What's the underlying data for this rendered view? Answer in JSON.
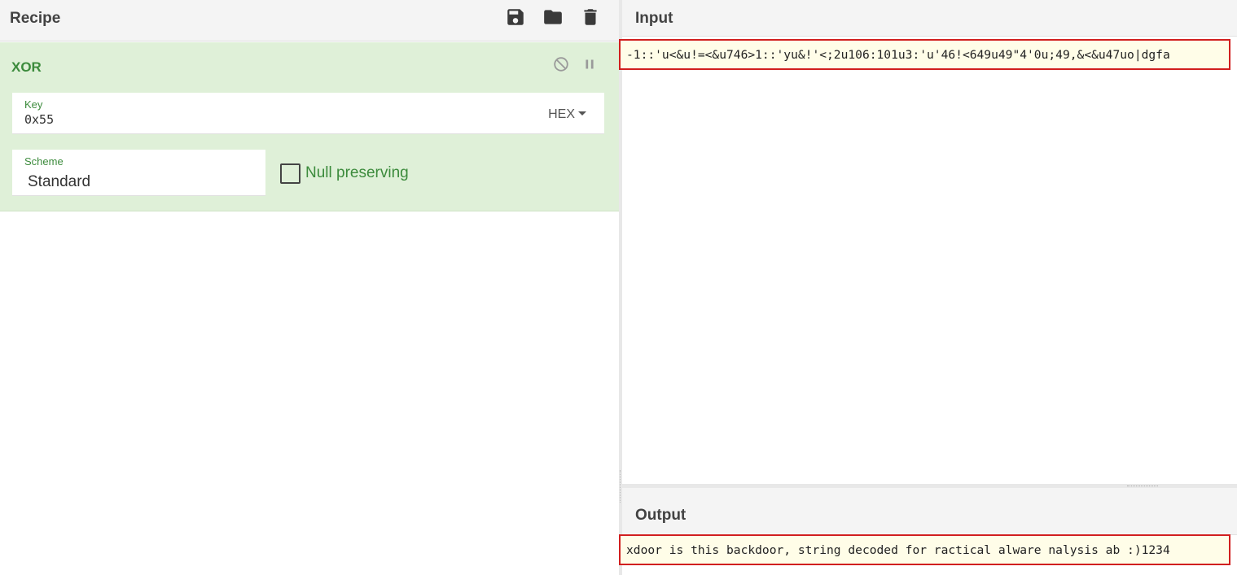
{
  "recipe": {
    "title": "Recipe",
    "icons": {
      "save": "save-icon",
      "load": "folder-icon",
      "clear": "trash-icon"
    },
    "operation": {
      "name": "XOR",
      "icons": {
        "disable": "disable-icon",
        "pause": "pause-icon"
      },
      "key": {
        "label": "Key",
        "value": "0x55",
        "type": "HEX"
      },
      "scheme": {
        "label": "Scheme",
        "value": "Standard"
      },
      "null_preserving": {
        "label": "Null preserving",
        "checked": false
      }
    }
  },
  "input": {
    "title": "Input",
    "text": "-1::'u<&u!=<&u746>1::'yu&!'<;2u106:101u3:'u'46!<649u49\"4'0u;49,&<&u47uo|dgfa"
  },
  "output": {
    "title": "Output",
    "text": "xdoor is this backdoor, string decoded for ractical alware nalysis ab :)1234"
  },
  "colors": {
    "operation_bg": "#dff0d8",
    "operation_text": "#3c8b3c",
    "highlight_border": "#d11f1f",
    "text_bg": "#fffde8"
  }
}
